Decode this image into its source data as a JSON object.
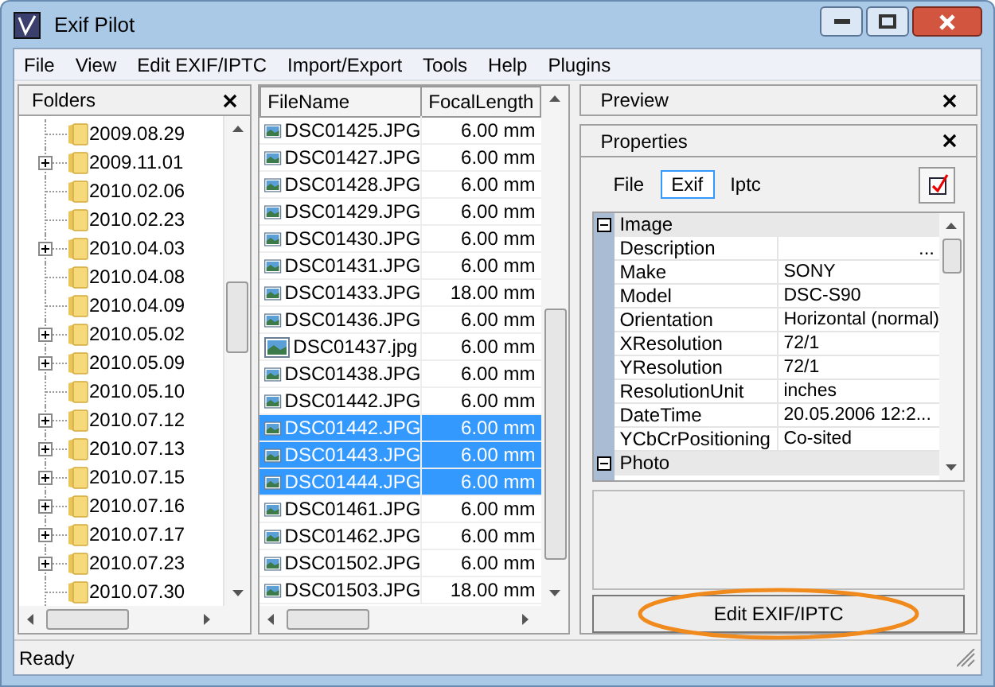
{
  "window": {
    "title": "Exif Pilot"
  },
  "menu": [
    "File",
    "View",
    "Edit EXIF/IPTC",
    "Import/Export",
    "Tools",
    "Help",
    "Plugins"
  ],
  "folders": {
    "title": "Folders",
    "items": [
      {
        "label": "2009.08.29",
        "expandable": false
      },
      {
        "label": "2009.11.01",
        "expandable": true
      },
      {
        "label": "2010.02.06",
        "expandable": false
      },
      {
        "label": "2010.02.23",
        "expandable": false
      },
      {
        "label": "2010.04.03",
        "expandable": true
      },
      {
        "label": "2010.04.08",
        "expandable": false
      },
      {
        "label": "2010.04.09",
        "expandable": false
      },
      {
        "label": "2010.05.02",
        "expandable": true
      },
      {
        "label": "2010.05.09",
        "expandable": true
      },
      {
        "label": "2010.05.10",
        "expandable": false
      },
      {
        "label": "2010.07.12",
        "expandable": true
      },
      {
        "label": "2010.07.13",
        "expandable": true
      },
      {
        "label": "2010.07.15",
        "expandable": true
      },
      {
        "label": "2010.07.16",
        "expandable": true
      },
      {
        "label": "2010.07.17",
        "expandable": true
      },
      {
        "label": "2010.07.23",
        "expandable": true
      },
      {
        "label": "2010.07.30",
        "expandable": false
      }
    ]
  },
  "files": {
    "columns": [
      "FileName",
      "FocalLength"
    ],
    "rows": [
      {
        "name": "DSC01425.JPG",
        "focal": "6.00 mm",
        "selected": false
      },
      {
        "name": "DSC01427.JPG",
        "focal": "6.00 mm",
        "selected": false
      },
      {
        "name": "DSC01428.JPG",
        "focal": "6.00 mm",
        "selected": false
      },
      {
        "name": "DSC01429.JPG",
        "focal": "6.00 mm",
        "selected": false
      },
      {
        "name": "DSC01430.JPG",
        "focal": "6.00 mm",
        "selected": false
      },
      {
        "name": "DSC01431.JPG",
        "focal": "6.00 mm",
        "selected": false
      },
      {
        "name": "DSC01433.JPG",
        "focal": "18.00 mm",
        "selected": false
      },
      {
        "name": "DSC01436.JPG",
        "focal": "6.00 mm",
        "selected": false
      },
      {
        "name": "DSC01437.jpg",
        "focal": "6.00 mm",
        "selected": false
      },
      {
        "name": "DSC01438.JPG",
        "focal": "6.00 mm",
        "selected": false
      },
      {
        "name": "DSC01442.JPG",
        "focal": "6.00 mm",
        "selected": false
      },
      {
        "name": "DSC01442.JPG",
        "focal": "6.00 mm",
        "selected": true
      },
      {
        "name": "DSC01443.JPG",
        "focal": "6.00 mm",
        "selected": true
      },
      {
        "name": "DSC01444.JPG",
        "focal": "6.00 mm",
        "selected": true
      },
      {
        "name": "DSC01461.JPG",
        "focal": "6.00 mm",
        "selected": false
      },
      {
        "name": "DSC01462.JPG",
        "focal": "6.00 mm",
        "selected": false
      },
      {
        "name": "DSC01502.JPG",
        "focal": "6.00 mm",
        "selected": false
      },
      {
        "name": "DSC01503.JPG",
        "focal": "18.00 mm",
        "selected": false
      }
    ]
  },
  "preview": {
    "title": "Preview"
  },
  "properties": {
    "title": "Properties",
    "tabs": [
      {
        "label": "File",
        "selected": false
      },
      {
        "label": "Exif",
        "selected": true
      },
      {
        "label": "Iptc",
        "selected": false
      }
    ],
    "groups": [
      {
        "label": "Image",
        "expanded": true,
        "rows": [
          {
            "name": "Description",
            "value": "...",
            "kind": "ellipsis"
          },
          {
            "name": "Make",
            "value": "SONY",
            "kind": "text"
          },
          {
            "name": "Model",
            "value": "DSC-S90",
            "kind": "text"
          },
          {
            "name": "Orientation",
            "value": "Horizontal (normal)",
            "kind": "text"
          },
          {
            "name": "XResolution",
            "value": "72/1",
            "kind": "text"
          },
          {
            "name": "YResolution",
            "value": "72/1",
            "kind": "text"
          },
          {
            "name": "ResolutionUnit",
            "value": "inches",
            "kind": "text"
          },
          {
            "name": "DateTime",
            "value": "20.05.2006 12:2...",
            "kind": "text"
          },
          {
            "name": "YCbCrPositioning",
            "value": "Co-sited",
            "kind": "text"
          }
        ]
      },
      {
        "label": "Photo",
        "expanded": true
      }
    ],
    "button": "Edit EXIF/IPTC"
  },
  "status_bar": "Ready"
}
